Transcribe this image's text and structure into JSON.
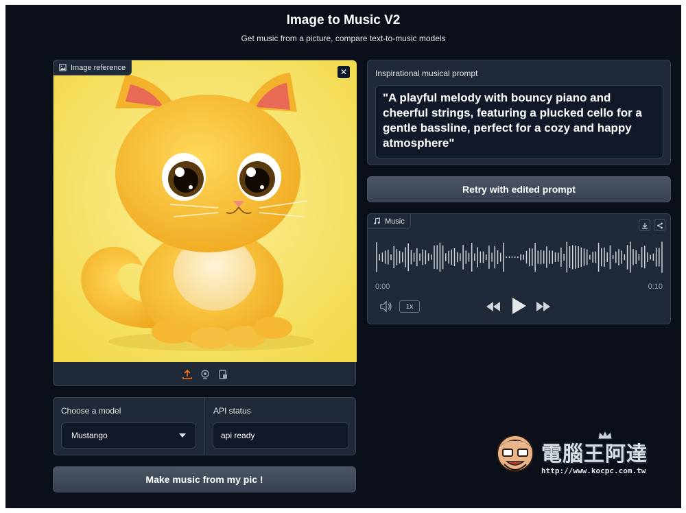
{
  "header": {
    "title": "Image to Music V2",
    "subtitle": "Get music from a picture, compare text-to-music models"
  },
  "image_panel": {
    "label": "Image reference",
    "close_symbol": "✕",
    "toolbar_icons": [
      "upload-icon",
      "webcam-icon",
      "clipboard-icon"
    ]
  },
  "model": {
    "label": "Choose a model",
    "selected": "Mustango"
  },
  "api_status": {
    "label": "API status",
    "value": "api ready"
  },
  "make_button": "Make music from my pic !",
  "prompt": {
    "label": "Inspirational musical prompt",
    "value": "\"A playful melody with bouncy piano and cheerful strings, featuring a plucked cello for a gentle bassline, perfect for a cozy and happy atmosphere\""
  },
  "retry_button": "Retry with edited prompt",
  "music": {
    "label": "Music",
    "time_start": "0:00",
    "time_end": "0:10",
    "speed": "1x",
    "progress": 0
  },
  "watermark": {
    "brand": "電腦王阿達",
    "url": "http://www.kocpc.com.tw"
  },
  "colors": {
    "background": "#0b0f19",
    "panel": "#1f2937",
    "accent": "#f97316",
    "image_bg": "#f6e26a"
  }
}
